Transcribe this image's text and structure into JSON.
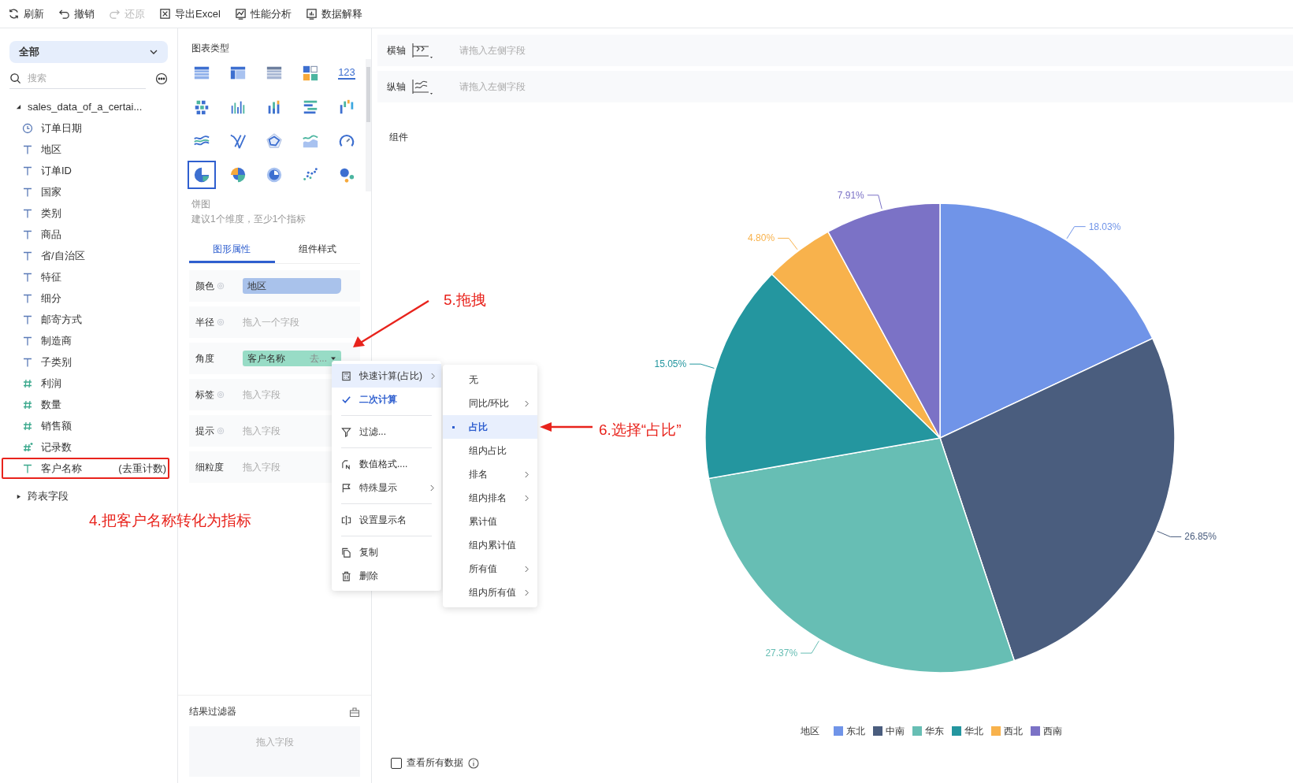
{
  "toolbar": [
    {
      "kind": "refresh",
      "label": "刷新",
      "disabled": false
    },
    {
      "kind": "undo",
      "label": "撤销",
      "disabled": false
    },
    {
      "kind": "redo",
      "label": "还原",
      "disabled": true
    },
    {
      "kind": "excel",
      "label": "导出Excel",
      "disabled": false
    },
    {
      "kind": "perf",
      "label": "性能分析",
      "disabled": false
    },
    {
      "kind": "explain",
      "label": "数据解释",
      "disabled": false
    }
  ],
  "sidebar": {
    "scope": "全部",
    "search": {
      "placeholder": "搜索"
    },
    "dataset": {
      "name": "sales_data_of_a_certai...",
      "expanded": true,
      "fields": [
        {
          "kind": "date",
          "name": "订单日期",
          "highlighted": false
        },
        {
          "kind": "text",
          "name": "地区",
          "highlighted": false
        },
        {
          "kind": "text",
          "name": "订单ID",
          "highlighted": false
        },
        {
          "kind": "text",
          "name": "国家",
          "highlighted": false
        },
        {
          "kind": "text",
          "name": "类别",
          "highlighted": false
        },
        {
          "kind": "text",
          "name": "商品",
          "highlighted": false
        },
        {
          "kind": "text",
          "name": "省/自治区",
          "highlighted": false
        },
        {
          "kind": "text",
          "name": "特征",
          "highlighted": false
        },
        {
          "kind": "text",
          "name": "细分",
          "highlighted": false
        },
        {
          "kind": "text",
          "name": "邮寄方式",
          "highlighted": false
        },
        {
          "kind": "text",
          "name": "制造商",
          "highlighted": false
        },
        {
          "kind": "text",
          "name": "子类别",
          "highlighted": false
        },
        {
          "kind": "number",
          "name": "利润",
          "highlighted": false
        },
        {
          "kind": "number",
          "name": "数量",
          "highlighted": false
        },
        {
          "kind": "number",
          "name": "销售额",
          "highlighted": false
        },
        {
          "kind": "count",
          "name": "记录数",
          "highlighted": false
        },
        {
          "kind": "text-measure",
          "name": "客户名称",
          "aggregate": "(去重计数)",
          "highlighted": true
        }
      ]
    },
    "cross_table": {
      "name": "跨表字段",
      "expanded": false
    }
  },
  "chart_panel": {
    "title": "图表类型",
    "types": [
      {
        "kind": "table",
        "selected": false
      },
      {
        "kind": "pivot",
        "selected": false
      },
      {
        "kind": "detail",
        "selected": false
      },
      {
        "kind": "card",
        "selected": false
      },
      {
        "kind": "kpi",
        "label": "123",
        "selected": false
      },
      {
        "kind": "heat",
        "selected": false
      },
      {
        "kind": "bar",
        "selected": false
      },
      {
        "kind": "stacked",
        "selected": false
      },
      {
        "kind": "hbar",
        "selected": false
      },
      {
        "kind": "waterfall",
        "selected": false
      },
      {
        "kind": "line",
        "selected": false
      },
      {
        "kind": "cross",
        "selected": false
      },
      {
        "kind": "radar",
        "selected": false
      },
      {
        "kind": "area",
        "selected": false
      },
      {
        "kind": "gauge",
        "selected": false
      },
      {
        "kind": "pie",
        "selected": true
      },
      {
        "kind": "rose",
        "selected": false
      },
      {
        "kind": "donut",
        "selected": false
      },
      {
        "kind": "scatter",
        "selected": false
      },
      {
        "kind": "bubble",
        "selected": false
      }
    ],
    "selected_name": "饼图",
    "hint": "建议1个维度，至少1个指标",
    "tabs": [
      {
        "label": "图形属性",
        "selected": true
      },
      {
        "label": "组件样式",
        "selected": false
      }
    ],
    "slots": [
      {
        "label": "颜色",
        "settings": true,
        "field": {
          "name": "地区",
          "kind": "dimension"
        }
      },
      {
        "label": "半径",
        "settings": true,
        "placeholder": "拖入一个字段"
      },
      {
        "label": "角度",
        "settings": false,
        "field": {
          "name": "客户名称",
          "aggregate": "去...",
          "kind": "measure"
        }
      },
      {
        "label": "标签",
        "settings": true,
        "placeholder": "拖入字段"
      },
      {
        "label": "提示",
        "settings": true,
        "placeholder": "拖入字段"
      },
      {
        "label": "细粒度",
        "settings": false,
        "placeholder": "拖入字段"
      }
    ],
    "result_filter": {
      "title": "结果过滤器",
      "placeholder": "拖入字段"
    }
  },
  "axes": [
    {
      "kind": "x",
      "label": "横轴",
      "placeholder": "请拖入左侧字段"
    },
    {
      "kind": "y",
      "label": "纵轴",
      "placeholder": "请拖入左侧字段"
    }
  ],
  "component_title": "组件",
  "chart_data": {
    "type": "pie",
    "categories": [
      "东北",
      "中南",
      "华东",
      "华北",
      "西北",
      "西南"
    ],
    "values": [
      18.03,
      26.85,
      27.37,
      15.05,
      4.8,
      7.91
    ],
    "value_labels": [
      "18.03%",
      "26.85%",
      "27.37%",
      "15.05%",
      "4.80%",
      "7.91%"
    ]
  },
  "legend": {
    "title": "地区",
    "items": [
      {
        "color": "#7094e8"
      },
      {
        "color": "#4a5d7e"
      },
      {
        "color": "#67beb4"
      },
      {
        "color": "#24969f"
      },
      {
        "color": "#f8b24c"
      },
      {
        "color": "#7b72c6"
      }
    ]
  },
  "view_all": {
    "label": "查看所有数据",
    "checked": false
  },
  "context_menu": [
    {
      "kind": "calc",
      "label": "快速计算(占比)",
      "submenu": true,
      "highlighted": true,
      "checked": false,
      "divider_before": false
    },
    {
      "kind": "check",
      "label": "二次计算",
      "submenu": false,
      "highlighted": false,
      "checked": true,
      "divider_before": false
    },
    {
      "kind": "filter",
      "label": "过滤...",
      "submenu": false,
      "highlighted": false,
      "checked": false,
      "divider_before": true
    },
    {
      "kind": "format",
      "label": "数值格式....",
      "submenu": false,
      "highlighted": false,
      "checked": false,
      "divider_before": true
    },
    {
      "kind": "flag",
      "label": "特殊显示",
      "submenu": true,
      "highlighted": false,
      "checked": false,
      "divider_before": false
    },
    {
      "kind": "rename",
      "label": "设置显示名",
      "submenu": false,
      "highlighted": false,
      "checked": false,
      "divider_before": true
    },
    {
      "kind": "copy",
      "label": "复制",
      "submenu": false,
      "highlighted": false,
      "checked": false,
      "divider_before": true
    },
    {
      "kind": "delete",
      "label": "删除",
      "submenu": false,
      "highlighted": false,
      "checked": false,
      "divider_before": false
    }
  ],
  "submenu": [
    {
      "label": "无",
      "submenu": false,
      "selected": false
    },
    {
      "label": "同比/环比",
      "submenu": true,
      "selected": false
    },
    {
      "label": "占比",
      "submenu": false,
      "selected": true
    },
    {
      "label": "组内占比",
      "submenu": false,
      "selected": false
    },
    {
      "label": "排名",
      "submenu": true,
      "selected": false
    },
    {
      "label": "组内排名",
      "submenu": true,
      "selected": false
    },
    {
      "label": "累计值",
      "submenu": false,
      "selected": false
    },
    {
      "label": "组内累计值",
      "submenu": false,
      "selected": false
    },
    {
      "label": "所有值",
      "submenu": true,
      "selected": false
    },
    {
      "label": "组内所有值",
      "submenu": true,
      "selected": false
    }
  ],
  "annotations": {
    "field_note": "4.把客户名称转化为指标",
    "drag_note": "5.拖拽",
    "select_note": "6.选择“占比”"
  }
}
